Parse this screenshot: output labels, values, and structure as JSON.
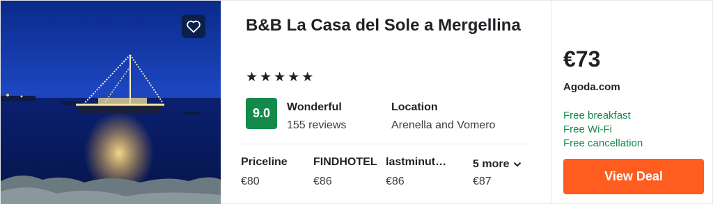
{
  "hotel": {
    "name": "B&B La Casa del Sole a Mergellina",
    "stars": "★★★★★",
    "score": "9.0",
    "rating_word": "Wonderful",
    "reviews": "155 reviews",
    "location_label": "Location",
    "location_value": "Arenella and Vomero",
    "photo_icon": "heart-icon"
  },
  "providers": [
    {
      "name": "Priceline",
      "price": "€80"
    },
    {
      "name": "FINDHOTEL",
      "price": "€86"
    },
    {
      "name": "lastminut…",
      "price": "€86"
    },
    {
      "name": "5 more",
      "price": "€87"
    }
  ],
  "deal": {
    "price": "€73",
    "provider": "Agoda.com",
    "perks": [
      "Free breakfast",
      "Free Wi-Fi",
      "Free cancellation"
    ],
    "button": "View Deal"
  },
  "colors": {
    "score_bg": "#128a4a",
    "perk_text": "#128a4a",
    "deal_button": "#ff5d1f"
  }
}
